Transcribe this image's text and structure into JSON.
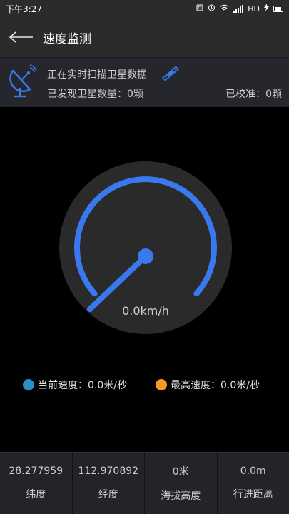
{
  "status_bar": {
    "time": "下午3:27",
    "network": "HD"
  },
  "app_bar": {
    "title": "速度监测"
  },
  "satellite": {
    "scan_text": "正在实时扫描卫星数据",
    "found_text": "已发现卫星数量：0颗",
    "calibrated_text": "已校准：0颗"
  },
  "gauge": {
    "speed_text": "0.0km/h",
    "current_speed_kmh": 0.0,
    "arc_color": "#3a78f0"
  },
  "legend": {
    "current": {
      "label": "当前速度：0.0米/秒",
      "color": "#2a8fc9"
    },
    "max": {
      "label": "最高速度：0.0米/秒",
      "color": "#f59a23"
    }
  },
  "stats": [
    {
      "value": "28.277959",
      "label": "纬度"
    },
    {
      "value": "112.970892",
      "label": "经度"
    },
    {
      "value": "0米",
      "label": "海拔高度"
    },
    {
      "value": "0.0m",
      "label": "行进距离"
    }
  ]
}
